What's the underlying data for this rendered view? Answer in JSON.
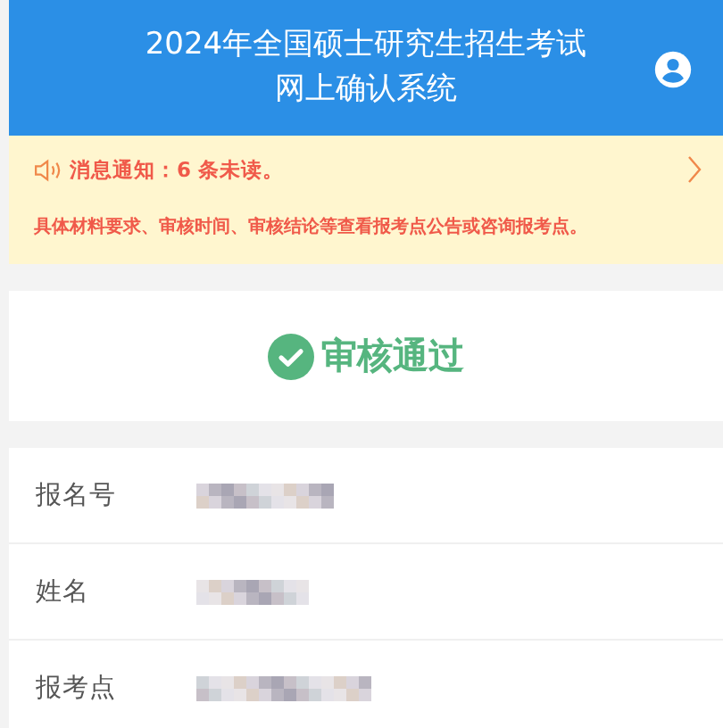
{
  "header": {
    "title_lines": [
      "2024年全国硕士研究生招生考试",
      "网上确认系统"
    ]
  },
  "notice": {
    "summary": "消息通知：6 条未读。",
    "detail": "具体材料要求、审核时间、审核结论等查看报考点公告或咨询报考点。"
  },
  "status": {
    "kind": "approved",
    "text": "审核通过"
  },
  "rows": [
    {
      "label": "报名号"
    },
    {
      "label": "姓名"
    },
    {
      "label": "报考点"
    }
  ]
}
